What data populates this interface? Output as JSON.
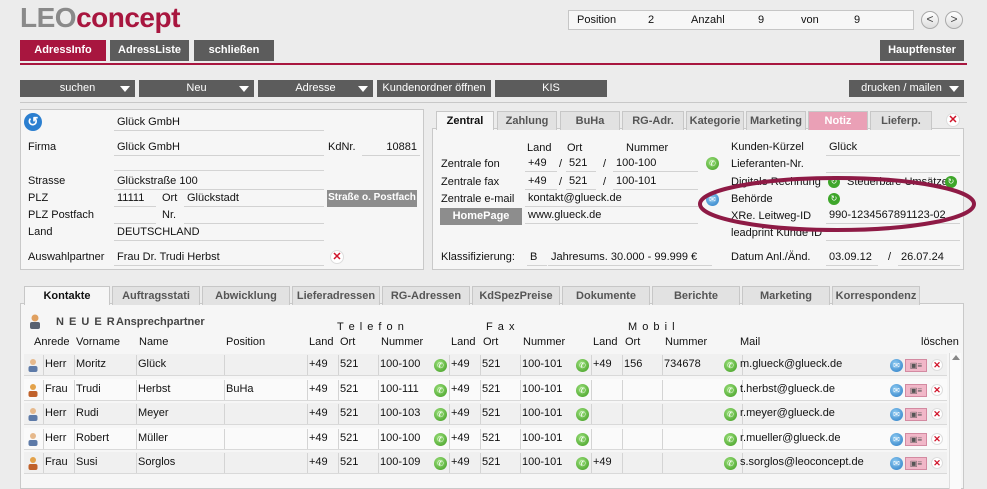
{
  "logo": {
    "part1": "LEO",
    "part2": "concept"
  },
  "nav": {
    "position_label": "Position",
    "position_value": "2",
    "anzahl_label": "Anzahl",
    "anzahl_value": "9",
    "von_label": "von",
    "von_value": "9",
    "prev": "<",
    "next": ">"
  },
  "main_tabs": {
    "adressinfo": "AdressInfo",
    "adressliste": "AdressListe",
    "schliessen": "schließen",
    "hauptfenster": "Hauptfenster"
  },
  "toolbar": {
    "suchen": "suchen",
    "neu": "Neu",
    "adresse": "Adresse",
    "kundenordner": "Kundenordner öffnen",
    "kis": "KIS",
    "drucken": "drucken / mailen"
  },
  "address": {
    "name_top": "Glück GmbH",
    "firma_label": "Firma",
    "firma_value": "Glück GmbH",
    "kdnr_label": "KdNr.",
    "kdnr_value": "10881",
    "strasse_label": "Strasse",
    "strasse_value": "Glückstraße 100",
    "plz_label": "PLZ",
    "plz_value": "11111",
    "ort_label": "Ort",
    "ort_value": "Glückstadt",
    "postfach_button": "Straße o. Postfach",
    "plz_postfach_label": "PLZ Postfach",
    "nr_label": "Nr.",
    "land_label": "Land",
    "land_value": "DEUTSCHLAND",
    "auswahl_label": "Auswahlpartner",
    "auswahl_value": "Frau Dr. Trudi Herbst"
  },
  "right_tabs": [
    "Zentral",
    "Zahlung",
    "BuHa",
    "RG-Adr.",
    "Kategorie",
    "Marketing",
    "Notiz",
    "Lieferp."
  ],
  "zentral": {
    "col_land": "Land",
    "col_ort": "Ort",
    "col_nummer": "Nummer",
    "fon_label": "Zentrale fon",
    "fon_land": "+49",
    "fon_ort": "521",
    "fon_nummer": "100-100",
    "fax_label": "Zentrale fax",
    "fax_land": "+49",
    "fax_ort": "521",
    "fax_nummer": "100-101",
    "email_label": "Zentrale e-mail",
    "email_value": "kontakt@glueck.de",
    "homepage_button": "HomePage",
    "homepage_value": "www.glueck.de",
    "klass_label": "Klassifizierung:",
    "klass_value": "B",
    "jahres_value": "Jahresums. 30.000 - 99.999 €",
    "kuerzel_label": "Kunden-Kürzel",
    "kuerzel_value": "Glück",
    "lieferanten_label": "Lieferanten-Nr.",
    "digitale_label": "Digitale Rechnung",
    "steuer_label": "Steuerbare Umsätze",
    "behoerde_label": "Behörde",
    "xre_label": "XRe. Leitweg-ID",
    "xre_value": "990-1234567891123-02",
    "leadprint_label": "leadprint Kunde ID",
    "datum_label": "Datum Anl./Änd.",
    "datum_anl": "03.09.12",
    "datum_sep": "/",
    "datum_aend": "26.07.24"
  },
  "bottom_tabs": [
    "Kontakte",
    "Auftragsstati",
    "Abwicklung",
    "Lieferadressen",
    "RG-Adressen",
    "KdSpezPreise",
    "Dokumente",
    "Berichte",
    "Marketing",
    "Korrespondenz"
  ],
  "contacts": {
    "new_label": "N E U E R",
    "new_sub": "Ansprechpartner",
    "group_telefon": "T e l e f o n",
    "group_fax": "F a x",
    "group_mobil": "M o b i l",
    "headers": {
      "anrede": "Anrede",
      "vorname": "Vorname",
      "name": "Name",
      "position": "Position",
      "land": "Land",
      "ort": "Ort",
      "nummer": "Nummer",
      "mail": "Mail",
      "loeschen": "löschen"
    },
    "rows": [
      {
        "anrede": "Herr",
        "vorname": "Moritz",
        "name": "Glück",
        "position": "",
        "tel_land": "+49",
        "tel_ort": "521",
        "tel_nr": "100-100",
        "fax_land": "+49",
        "fax_ort": "521",
        "fax_nr": "100-101",
        "mob_land": "+49",
        "mob_ort": "156",
        "mob_nr": "734678",
        "mail": "m.glueck@glueck.de"
      },
      {
        "anrede": "Frau",
        "vorname": "Trudi",
        "name": "Herbst",
        "position": "BuHa",
        "tel_land": "+49",
        "tel_ort": "521",
        "tel_nr": "100-111",
        "fax_land": "+49",
        "fax_ort": "521",
        "fax_nr": "100-101",
        "mob_land": "",
        "mob_ort": "",
        "mob_nr": "",
        "mail": "t.herbst@glueck.de"
      },
      {
        "anrede": "Herr",
        "vorname": "Rudi",
        "name": "Meyer",
        "position": "",
        "tel_land": "+49",
        "tel_ort": "521",
        "tel_nr": "100-103",
        "fax_land": "+49",
        "fax_ort": "521",
        "fax_nr": "100-101",
        "mob_land": "",
        "mob_ort": "",
        "mob_nr": "",
        "mail": "r.meyer@glueck.de"
      },
      {
        "anrede": "Herr",
        "vorname": "Robert",
        "name": "Müller",
        "position": "",
        "tel_land": "+49",
        "tel_ort": "521",
        "tel_nr": "100-100",
        "fax_land": "+49",
        "fax_ort": "521",
        "fax_nr": "100-101",
        "mob_land": "",
        "mob_ort": "",
        "mob_nr": "",
        "mail": "r.mueller@glueck.de"
      },
      {
        "anrede": "Frau",
        "vorname": "Susi",
        "name": "Sorglos",
        "position": "",
        "tel_land": "+49",
        "tel_ort": "521",
        "tel_nr": "100-109",
        "fax_land": "+49",
        "fax_ort": "521",
        "fax_nr": "100-101",
        "mob_land": "+49",
        "mob_ort": "",
        "mob_nr": "",
        "mail": "s.sorglos@leoconcept.de"
      }
    ]
  },
  "colors": {
    "brand": "#a8163f",
    "button_dark": "#5c5c5c",
    "annotation": "#8e1a45"
  }
}
